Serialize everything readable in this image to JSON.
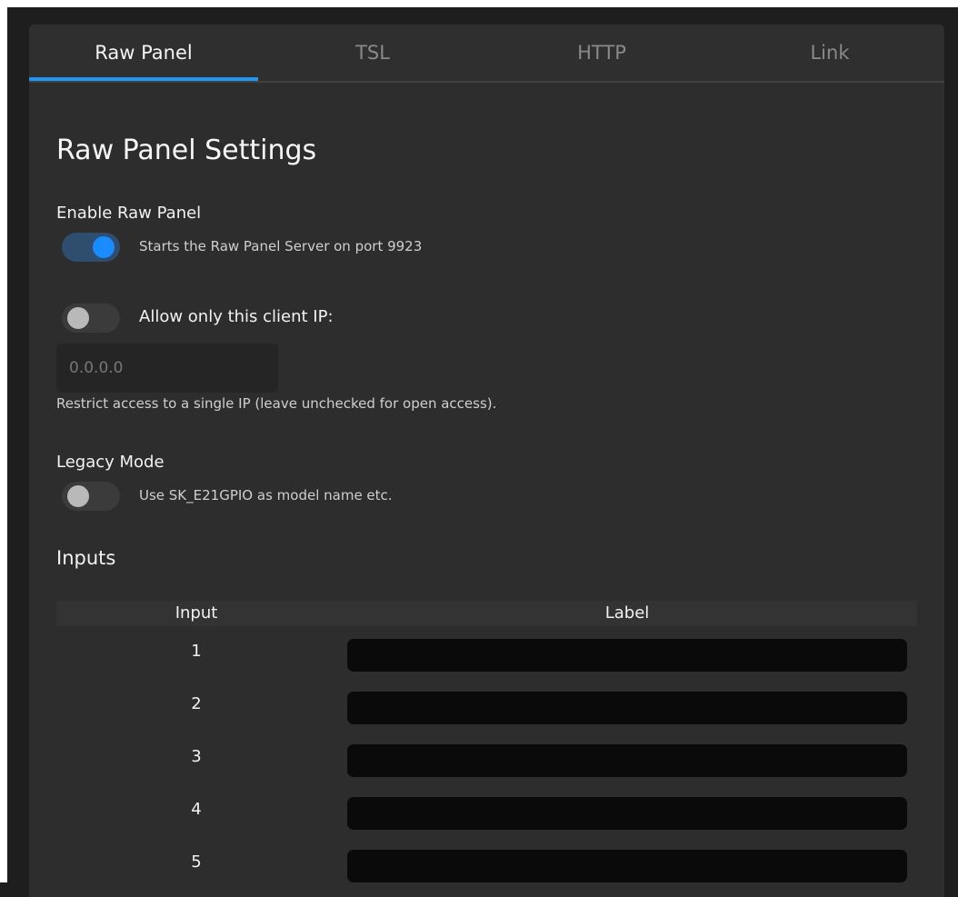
{
  "tabs": [
    {
      "label": "Raw Panel",
      "active": true
    },
    {
      "label": "TSL",
      "active": false
    },
    {
      "label": "HTTP",
      "active": false
    },
    {
      "label": "Link",
      "active": false
    }
  ],
  "page_title": "Raw Panel Settings",
  "enable_raw_panel": {
    "label": "Enable Raw Panel",
    "description": "Starts the Raw Panel Server on port 9923",
    "enabled": true
  },
  "client_ip": {
    "label": "Allow only this client IP:",
    "enabled": false,
    "placeholder": "0.0.0.0",
    "value": "",
    "help": "Restrict access to a single IP (leave unchecked for open access)."
  },
  "legacy_mode": {
    "label": "Legacy Mode",
    "description": "Use SK_E21GPIO as model name etc.",
    "enabled": false
  },
  "inputs_section": {
    "title": "Inputs",
    "columns": [
      "Input",
      "Label"
    ],
    "rows": [
      {
        "input": "1",
        "label": ""
      },
      {
        "input": "2",
        "label": ""
      },
      {
        "input": "3",
        "label": ""
      },
      {
        "input": "4",
        "label": ""
      },
      {
        "input": "5",
        "label": ""
      }
    ]
  },
  "colors": {
    "accent": "#2196f3",
    "toggle_on_track": "#2e4d6f",
    "toggle_on_knob": "#1a8cff",
    "panel_bg": "#2d2d2d",
    "input_bg": "#0a0a0a"
  }
}
